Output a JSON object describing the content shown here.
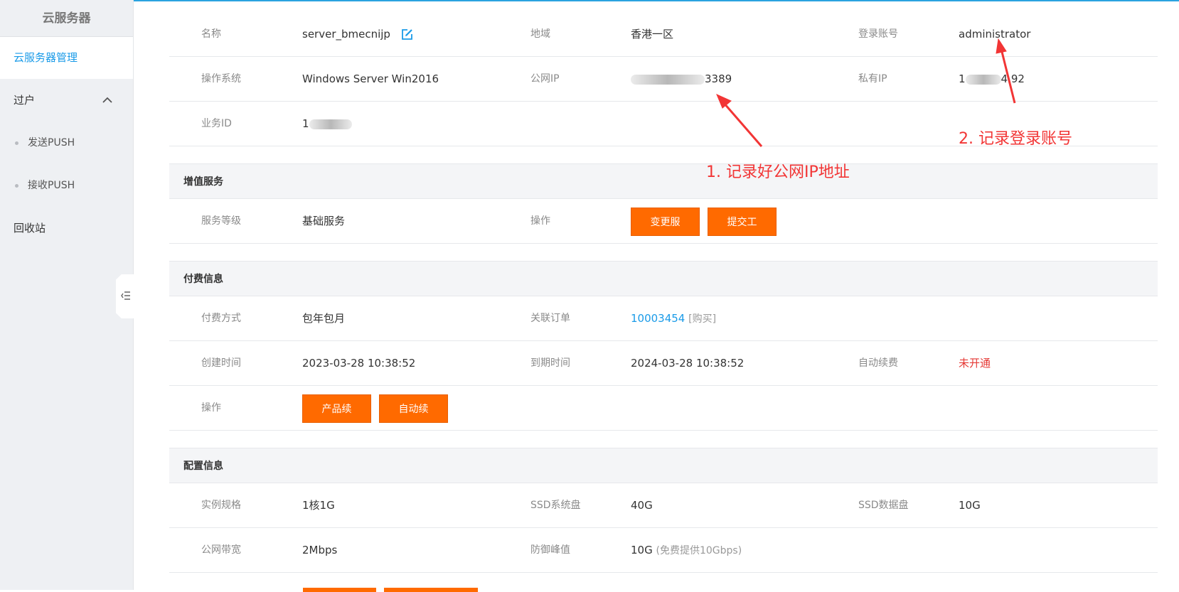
{
  "sidebar": {
    "title": "云服务器",
    "active_item": "云服务器管理",
    "group_label": "过户",
    "sub_items": [
      {
        "label": "发送PUSH"
      },
      {
        "label": "接收PUSH"
      }
    ],
    "recycle_label": "回收站"
  },
  "basic": {
    "name_label": "名称",
    "name_value": "server_bmecnijp",
    "region_label": "地域",
    "region_value": "香港一区",
    "login_label": "登录账号",
    "login_value": "administrator",
    "os_label": "操作系统",
    "os_value": "Windows Server Win2016",
    "public_ip_label": "公网IP",
    "public_ip_visible": "3389",
    "private_ip_label": "私有IP",
    "private_ip_visible_a": "1",
    "private_ip_visible_b": "4.92",
    "business_id_label": "业务ID",
    "business_id_visible": "1"
  },
  "value_added": {
    "section_title": "增值服务",
    "level_label": "服务等级",
    "level_value": "基础服务",
    "op_label": "操作",
    "change_button": "变更服务",
    "ticket_button": "提交工单"
  },
  "billing": {
    "section_title": "付费信息",
    "pay_mode_label": "付费方式",
    "pay_mode_value": "包年包月",
    "order_label": "关联订单",
    "order_value": "10003454",
    "order_note": "[购买]",
    "created_label": "创建时间",
    "created_value": "2023-03-28 10:38:52",
    "expire_label": "到期时间",
    "expire_value": "2024-03-28 10:38:52",
    "auto_renew_label": "自动续费",
    "auto_renew_value": "未开通",
    "op_label": "操作",
    "renew_button": "产品续费",
    "auto_renew_button": "自动续费"
  },
  "config": {
    "section_title": "配置信息",
    "spec_label": "实例规格",
    "spec_value": "1核1G",
    "ssd_sys_label": "SSD系统盘",
    "ssd_sys_value": "40G",
    "ssd_data_label": "SSD数据盘",
    "ssd_data_value": "10G",
    "bandwidth_label": "公网带宽",
    "bandwidth_value": "2Mbps",
    "defense_label": "防御峰值",
    "defense_value": "10G",
    "defense_note": "(免费提供10Gbps)"
  },
  "annotations": {
    "note1": "1. 记录好公网IP地址",
    "note2": "2. 记录登录账号"
  },
  "colors": {
    "accent": "#1a9be8",
    "button": "#ff6a00",
    "annotation": "#f23535",
    "status_off": "#e53935"
  },
  "icons": {
    "edit": "edit-icon",
    "chevron": "chevron-up-icon",
    "collapse": "collapse-menu-icon"
  }
}
